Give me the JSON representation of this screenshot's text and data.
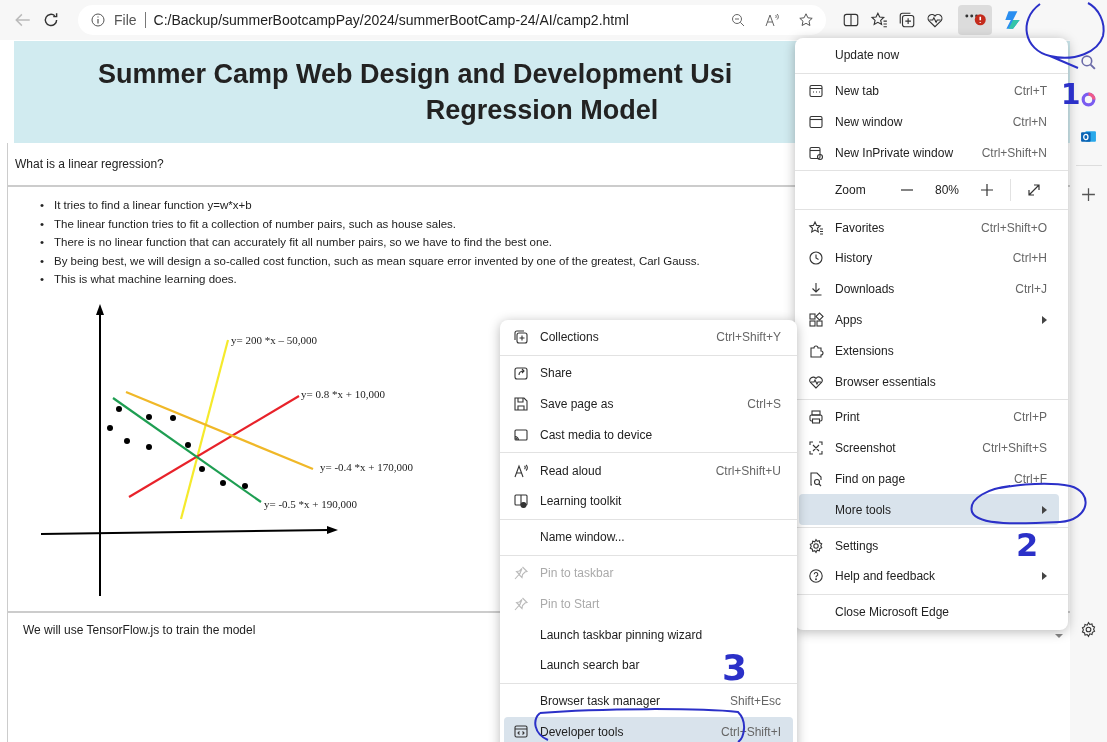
{
  "toolbar": {
    "back_disabled": true,
    "scheme": "File",
    "url": "C:/Backup/summerBootcampPay/2024/summerBootCamp-24/AI/camp2.html"
  },
  "page": {
    "title_lines": [
      "Summer Camp Web Design and Development Usi",
      "Regression Model"
    ],
    "question": "What is a linear regression?",
    "bullets": [
      {
        "marker": "•",
        "text": "It tries to find a linear function y=w*x+b"
      },
      {
        "marker": "•",
        "text": "The linear function tries to fit a collection of number pairs, such as house sales."
      },
      {
        "marker": "•",
        "text": "There is no linear function that can accurately fit all number pairs, so we have to find the best one."
      },
      {
        "marker": "•",
        "text": "By being best, we will design a so-called cost function, such as mean square error invented by one of the greatest, Carl Gauss."
      },
      {
        "marker": "•",
        "text": "This is what machine learning does."
      }
    ],
    "diagram": {
      "lines": [
        {
          "label": "y= 200 *x – 50,000",
          "color": "#f5ea2c"
        },
        {
          "label": "y= 0.8 *x + 10,000",
          "color": "#e8222a"
        },
        {
          "label": "y= -0.4 *x + 170,000",
          "color": "#f0b828"
        },
        {
          "label": "y= -0.5 *x + 190,000",
          "color": "#1e9e52"
        }
      ]
    },
    "footer_text": "We will use TensorFlow.js to train the model"
  },
  "main_menu": {
    "groups": [
      [
        {
          "kind": "item",
          "label": "Update now",
          "selected": false
        }
      ],
      [
        {
          "kind": "item",
          "label": "New tab",
          "shortcut": "Ctrl+T",
          "selected": false
        },
        {
          "kind": "item",
          "label": "New window",
          "shortcut": "Ctrl+N",
          "selected": false
        },
        {
          "kind": "item",
          "label": "New InPrivate window",
          "shortcut": "Ctrl+Shift+N",
          "selected": false
        }
      ],
      [
        {
          "kind": "zoom",
          "label": "Zoom",
          "value": "80%",
          "selected": false
        }
      ],
      [
        {
          "kind": "item",
          "label": "Favorites",
          "shortcut": "Ctrl+Shift+O",
          "selected": false
        },
        {
          "kind": "item",
          "label": "History",
          "shortcut": "Ctrl+H",
          "selected": false
        },
        {
          "kind": "item",
          "label": "Downloads",
          "shortcut": "Ctrl+J",
          "selected": false
        },
        {
          "kind": "item",
          "label": "Apps",
          "submenu": true,
          "selected": false
        },
        {
          "kind": "item",
          "label": "Extensions",
          "selected": false
        },
        {
          "kind": "item",
          "label": "Browser essentials",
          "selected": false
        }
      ],
      [
        {
          "kind": "item",
          "label": "Print",
          "shortcut": "Ctrl+P",
          "selected": false
        },
        {
          "kind": "item",
          "label": "Screenshot",
          "shortcut": "Ctrl+Shift+S",
          "selected": false
        },
        {
          "kind": "item",
          "label": "Find on page",
          "shortcut": "Ctrl+F",
          "selected": false
        },
        {
          "kind": "item",
          "label": "More tools",
          "submenu": true,
          "selected": true
        }
      ],
      [
        {
          "kind": "item",
          "label": "Settings",
          "selected": false
        },
        {
          "kind": "item",
          "label": "Help and feedback",
          "submenu": true,
          "selected": false
        }
      ],
      [
        {
          "kind": "item",
          "label": "Close Microsoft Edge",
          "selected": false
        }
      ]
    ]
  },
  "more_tools_menu": {
    "groups": [
      [
        {
          "kind": "item",
          "label": "Collections",
          "shortcut": "Ctrl+Shift+Y",
          "selected": false,
          "disabled": false
        }
      ],
      [
        {
          "kind": "item",
          "label": "Share",
          "selected": false,
          "disabled": false
        },
        {
          "kind": "item",
          "label": "Save page as",
          "shortcut": "Ctrl+S",
          "selected": false,
          "disabled": false
        },
        {
          "kind": "item",
          "label": "Cast media to device",
          "selected": false,
          "disabled": false
        }
      ],
      [
        {
          "kind": "item",
          "label": "Read aloud",
          "shortcut": "Ctrl+Shift+U",
          "selected": false,
          "disabled": false
        },
        {
          "kind": "item",
          "label": "Learning toolkit",
          "selected": false,
          "disabled": false
        }
      ],
      [
        {
          "kind": "item",
          "label": "Name window...",
          "selected": false,
          "disabled": false
        }
      ],
      [
        {
          "kind": "item",
          "label": "Pin to taskbar",
          "selected": false,
          "disabled": true
        },
        {
          "kind": "item",
          "label": "Pin to Start",
          "selected": false,
          "disabled": true
        },
        {
          "kind": "item",
          "label": "Launch taskbar pinning wizard",
          "selected": false,
          "disabled": false
        },
        {
          "kind": "item",
          "label": "Launch search bar",
          "selected": false,
          "disabled": false
        }
      ],
      [
        {
          "kind": "item",
          "label": "Browser task manager",
          "shortcut": "Shift+Esc",
          "selected": false,
          "disabled": false
        },
        {
          "kind": "item",
          "label": "Developer tools",
          "shortcut": "Ctrl+Shift+I",
          "selected": true,
          "disabled": false
        }
      ]
    ]
  },
  "annotations": [
    "1",
    "2",
    "3"
  ]
}
